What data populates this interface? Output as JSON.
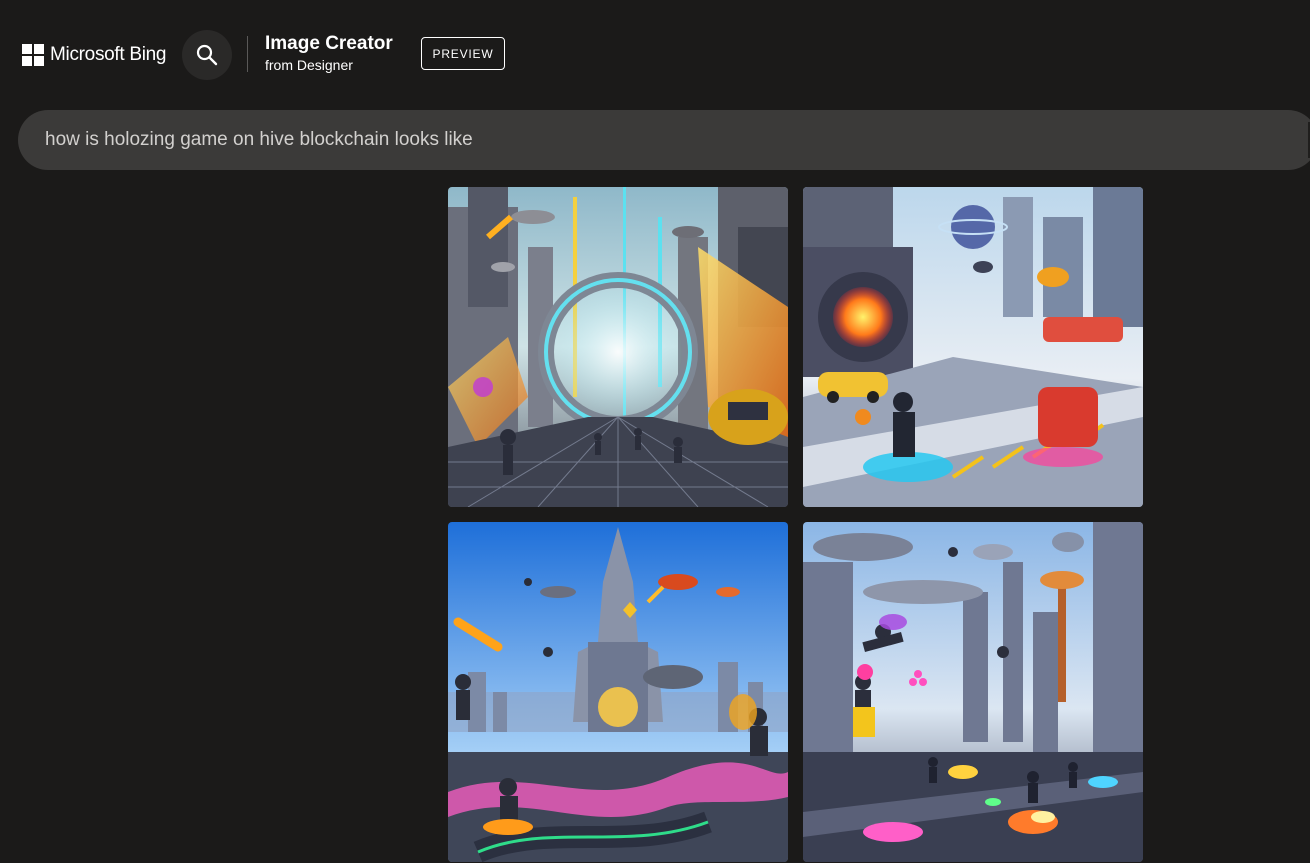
{
  "header": {
    "logo_text": "Microsoft Bing",
    "title": "Image Creator",
    "subtitle": "from Designer",
    "badge": "PREVIEW"
  },
  "prompt": {
    "value": "how is holozing game on hive blockchain looks like"
  },
  "icons": {
    "logo": "microsoft-squares-icon",
    "search": "search-icon"
  },
  "colors": {
    "page_bg": "#1b1a19",
    "prompt_bg": "#3b3a39",
    "search_circle_bg": "#2a2928",
    "text": "#ffffff",
    "prompt_text": "#d2d0ce"
  },
  "results": {
    "count": 4,
    "images": [
      {
        "subject": "futuristic city ring portal with characters running"
      },
      {
        "subject": "colorful futuristic arena with vehicles and robots"
      },
      {
        "subject": "blue-sky futuristic tower with flying ships and racetrack"
      },
      {
        "subject": "futuristic city with floating towers and flying characters"
      }
    ]
  }
}
